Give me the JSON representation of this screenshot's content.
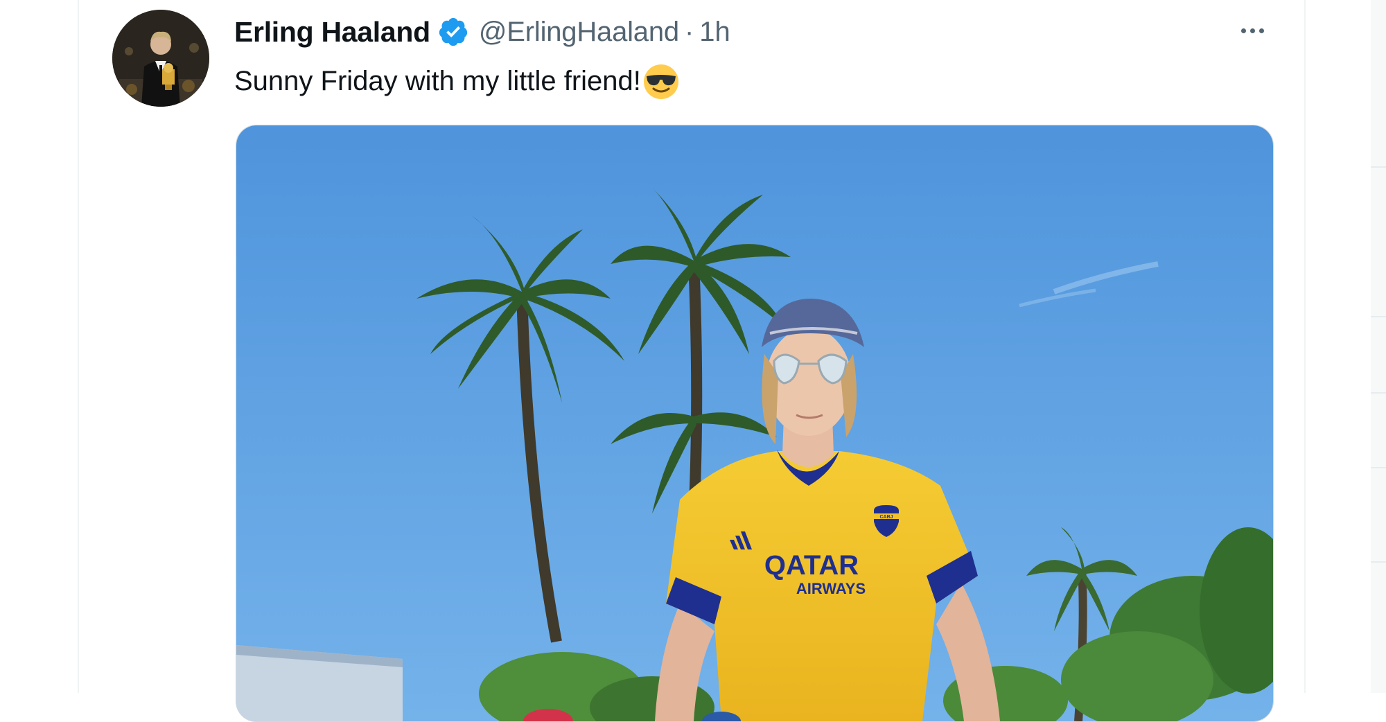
{
  "tweet": {
    "display_name": "Erling Haaland",
    "verified": true,
    "handle": "@ErlingHaaland",
    "separator": "·",
    "timestamp": "1h",
    "text": "Sunny Friday with my little friend!",
    "emoji": "smiling-face-with-sunglasses"
  },
  "media": {
    "jersey_text_line1": "QATAR",
    "jersey_text_line2": "AIRWAYS",
    "badge_text": "CABJ"
  },
  "colors": {
    "accent": "#1d9bf0",
    "text_primary": "#0f1419",
    "text_secondary": "#536471",
    "sky": "#5fa2e2",
    "jersey_yellow": "#f2c22a",
    "jersey_navy": "#1f2f8f"
  },
  "icons": {
    "verified": "verified-badge-icon",
    "more": "more-options-icon"
  }
}
